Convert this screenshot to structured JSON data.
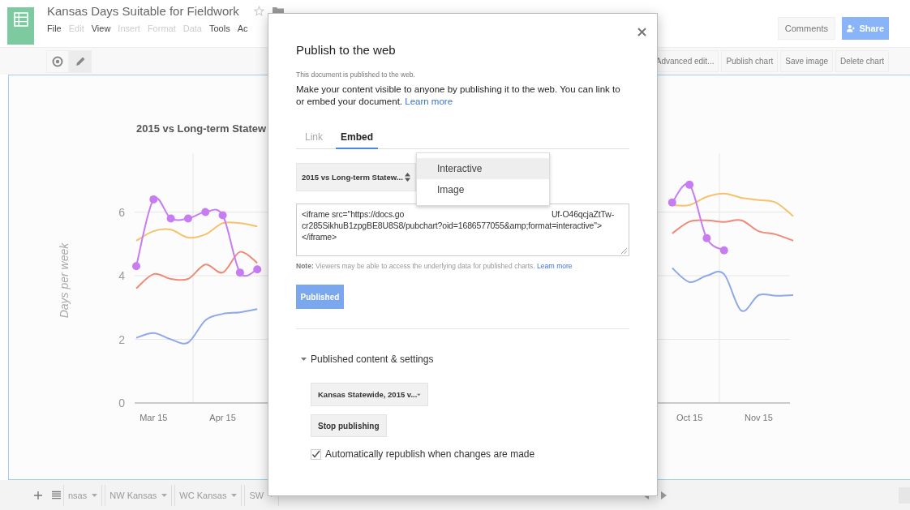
{
  "app": {
    "title": "Kansas Days Suitable for Fieldwork",
    "menu": [
      {
        "label": "File",
        "disabled": false
      },
      {
        "label": "Edit",
        "disabled": true
      },
      {
        "label": "View",
        "disabled": false
      },
      {
        "label": "Insert",
        "disabled": true
      },
      {
        "label": "Format",
        "disabled": true
      },
      {
        "label": "Data",
        "disabled": true
      },
      {
        "label": "Tools",
        "disabled": false
      },
      {
        "label": "Ac",
        "disabled": false
      }
    ],
    "comments_button": "Comments",
    "share_button": "Share"
  },
  "toolbar": {
    "mode_buttons": [
      {
        "kind": "view",
        "selected": false
      },
      {
        "kind": "edit",
        "selected": true
      }
    ],
    "actions": [
      "Advanced edit...",
      "Publish chart",
      "Save image",
      "Delete chart"
    ]
  },
  "chart": {
    "chart_data": {
      "type": "line",
      "title": "2015 vs Long-term Statew",
      "ylabel": "Days per week",
      "grid": true,
      "categories": [
        null,
        "Mar 15",
        null,
        null,
        null,
        "Apr 15",
        null,
        null,
        null,
        null,
        null,
        null,
        null,
        null,
        null,
        null,
        null,
        null,
        null,
        null,
        null,
        null,
        null,
        null,
        null,
        null,
        null,
        null,
        null,
        null,
        null,
        null,
        "Oct 15",
        null,
        null,
        null,
        "Nov 15",
        null,
        null
      ],
      "ylim": [
        0,
        7.85
      ],
      "yticks": [
        0,
        2,
        4,
        6
      ],
      "series": [
        {
          "color": "#8fa8e8",
          "marker": false,
          "values": [
            2.05,
            2.2,
            2.0,
            1.9,
            2.6,
            2.8,
            2.85,
            2.95,
            null,
            null,
            null,
            null,
            null,
            null,
            null,
            null,
            null,
            null,
            null,
            null,
            null,
            null,
            null,
            null,
            null,
            null,
            null,
            null,
            null,
            null,
            null,
            4.24,
            3.8,
            4.0,
            4.05,
            2.9,
            3.39,
            3.37,
            3.39
          ]
        },
        {
          "color": "#ee8a77",
          "marker": false,
          "values": [
            3.6,
            4.05,
            3.9,
            3.9,
            4.35,
            4.1,
            4.75,
            4.4,
            null,
            null,
            null,
            null,
            null,
            null,
            null,
            null,
            null,
            null,
            null,
            null,
            null,
            null,
            null,
            null,
            null,
            null,
            null,
            null,
            null,
            null,
            null,
            5.33,
            5.7,
            5.74,
            5.69,
            5.74,
            5.4,
            5.3,
            5.1
          ]
        },
        {
          "color": "#f6c26b",
          "marker": false,
          "values": [
            5.1,
            5.4,
            5.45,
            5.2,
            5.3,
            5.65,
            5.65,
            5.55,
            null,
            null,
            null,
            null,
            null,
            null,
            null,
            null,
            null,
            null,
            null,
            null,
            null,
            null,
            null,
            null,
            null,
            null,
            null,
            null,
            null,
            null,
            null,
            6.22,
            6.22,
            6.48,
            6.58,
            6.45,
            6.38,
            6.3,
            5.87
          ]
        },
        {
          "color": "#c77cf2",
          "marker": true,
          "values": [
            4.3,
            6.4,
            5.8,
            5.8,
            6.0,
            5.9,
            4.1,
            4.2,
            null,
            null,
            null,
            null,
            null,
            null,
            null,
            null,
            null,
            null,
            null,
            null,
            null,
            null,
            null,
            null,
            null,
            null,
            null,
            null,
            null,
            null,
            null,
            6.3,
            6.86,
            5.18,
            4.8,
            null,
            null,
            null,
            null
          ]
        }
      ]
    }
  },
  "sheet_tabs": [
    {
      "label": "nsas"
    },
    {
      "label": "NW Kansas"
    },
    {
      "label": "WC Kansas"
    },
    {
      "label": "SW"
    }
  ],
  "dialog": {
    "title": "Publish to the web",
    "status": "This document is published to the web.",
    "description": "Make your content visible to anyone by publishing it to the web. You can link to or embed your document.",
    "description_link": "Learn more",
    "tabs": [
      {
        "label": "Link",
        "selected": false
      },
      {
        "label": "Embed",
        "selected": true
      }
    ],
    "chart_select": "2015 vs Long-term Statew...",
    "format_menu": [
      {
        "label": "Interactive",
        "selected": true
      },
      {
        "label": "Image",
        "selected": false
      }
    ],
    "embed_code": {
      "line_1_start": "<iframe src=\"https://docs.go",
      "line_1_end": "Uf-O46qcjaZtTw-",
      "lines": [
        "cr285SikhuB1zpgBE8U8S8/pubchart?oid=1686577055&amp;format=interactive\">",
        "</iframe>"
      ]
    },
    "note": "**Note:** Viewers may be able to access the underlying data for published charts.",
    "note_link": "Learn more",
    "publish_button": {
      "label": "Published",
      "disabled": true
    },
    "section": {
      "title": "Published content & settings",
      "expanded": true,
      "content_select": "Kansas Statewide, 2015 v...",
      "stop_button": "Stop publishing",
      "auto_republish": {
        "label": "Automatically republish when changes are made",
        "checked": true
      }
    }
  }
}
